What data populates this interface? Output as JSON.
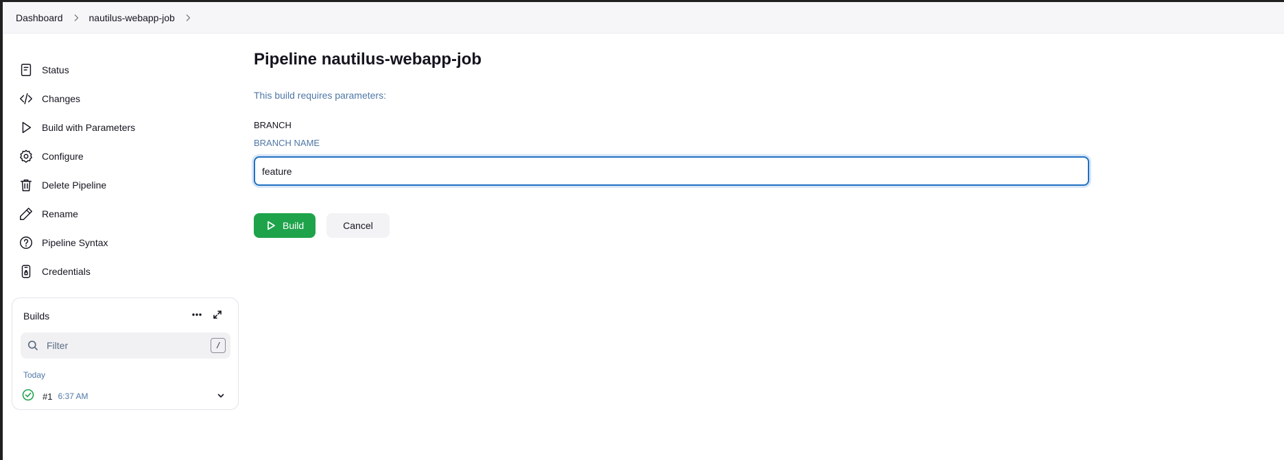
{
  "breadcrumb": {
    "items": [
      {
        "label": "Dashboard"
      },
      {
        "label": "nautilus-webapp-job"
      }
    ]
  },
  "sidebar": {
    "items": [
      {
        "label": "Status",
        "icon": "status-icon"
      },
      {
        "label": "Changes",
        "icon": "code-icon"
      },
      {
        "label": "Build with Parameters",
        "icon": "play-icon"
      },
      {
        "label": "Configure",
        "icon": "gear-icon"
      },
      {
        "label": "Delete Pipeline",
        "icon": "trash-icon"
      },
      {
        "label": "Rename",
        "icon": "pencil-icon"
      },
      {
        "label": "Pipeline Syntax",
        "icon": "help-icon"
      },
      {
        "label": "Credentials",
        "icon": "credentials-icon"
      }
    ]
  },
  "builds": {
    "title": "Builds",
    "filter_placeholder": "Filter",
    "filter_shortcut": "/",
    "group_label": "Today",
    "items": [
      {
        "number": "#1",
        "time": "6:37 AM",
        "status": "success"
      }
    ]
  },
  "main": {
    "title": "Pipeline nautilus-webapp-job",
    "notice": "This build requires parameters:",
    "parameter": {
      "name": "BRANCH",
      "description": "BRANCH NAME",
      "value": "feature"
    },
    "build_label": "Build",
    "cancel_label": "Cancel"
  },
  "colors": {
    "primary_green": "#1ea34a",
    "focus_blue": "#1f6fc2",
    "muted_blue": "#4f77a6"
  }
}
